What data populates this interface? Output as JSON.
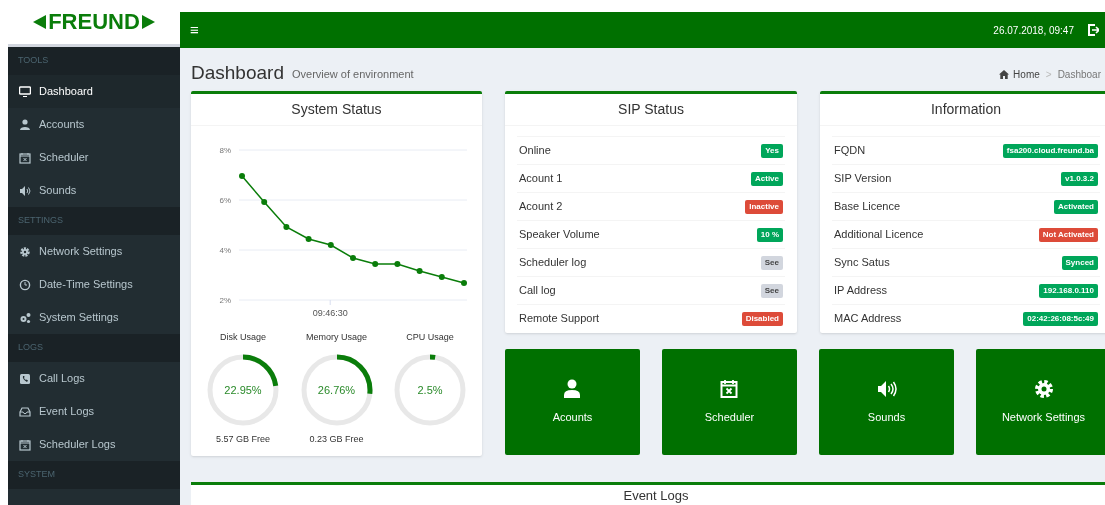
{
  "logo": {
    "text": "FREUND"
  },
  "topbar": {
    "menu_glyph": "≡",
    "datetime": "26.07.2018, 09:47"
  },
  "sidebar": {
    "sections": [
      {
        "title": "TOOLS",
        "items": [
          {
            "label": "Dashboard",
            "selected": true
          },
          {
            "label": "Accounts",
            "selected": false
          },
          {
            "label": "Scheduler",
            "selected": false
          },
          {
            "label": "Sounds",
            "selected": false
          }
        ]
      },
      {
        "title": "SETTINGS",
        "items": [
          {
            "label": "Network Settings",
            "selected": false
          },
          {
            "label": "Date-Time Settings",
            "selected": false
          },
          {
            "label": "System Settings",
            "selected": false
          }
        ]
      },
      {
        "title": "LOGS",
        "items": [
          {
            "label": "Call Logs",
            "selected": false
          },
          {
            "label": "Event Logs",
            "selected": false
          },
          {
            "label": "Scheduler Logs",
            "selected": false
          }
        ]
      },
      {
        "title": "SYSTEM"
      }
    ]
  },
  "page_header": {
    "title": "Dashboard",
    "subtitle": "Overview of environment",
    "breadcrumb": [
      "Home",
      "Dashboar"
    ],
    "breadcrumb_separator": ">"
  },
  "system_status": {
    "title": "System Status",
    "chart_data": {
      "type": "line",
      "series": [
        {
          "color": "#0a7d0a",
          "marker": true,
          "values": [
            6.96,
            5.92,
            4.92,
            4.44,
            4.2,
            3.68,
            3.44,
            3.44,
            3.16,
            2.92,
            2.68
          ]
        }
      ],
      "ylim": [
        2,
        8
      ],
      "yticks": [
        {
          "value": 2,
          "label": "2%"
        },
        {
          "value": 4,
          "label": "4%"
        },
        {
          "value": 6,
          "label": "6%"
        },
        {
          "value": 8,
          "label": "8%"
        }
      ],
      "annotations": [
        "09:46:30"
      ]
    },
    "gauges": [
      {
        "label": "Disk Usage",
        "reading": "22.95%",
        "level": 0.2295,
        "note": "5.57 GB Free"
      },
      {
        "label": "Memory Usage",
        "reading": "26.76%",
        "level": 0.2676,
        "note": "0.23 GB Free"
      },
      {
        "label": "CPU Usage",
        "reading": "2.5%",
        "level": 0.025
      }
    ]
  },
  "sip_status": {
    "title": "SIP Status",
    "rows": [
      {
        "label": "Online",
        "value": "Yes",
        "color": "#00a65a"
      },
      {
        "label": "Acount 1",
        "value": "Active",
        "color": "#00a65a"
      },
      {
        "label": "Acount 2",
        "value": "Inactive",
        "color": "#dd4b39"
      },
      {
        "label": "Speaker Volume",
        "value": "10 %",
        "color": "#00a65a"
      },
      {
        "label": "Scheduler log",
        "value": "See",
        "color": "#d2d6de"
      },
      {
        "label": "Call log",
        "value": "See",
        "color": "#d2d6de"
      },
      {
        "label": "Remote Support",
        "value": "Disabled",
        "color": "#dd4b39"
      }
    ]
  },
  "information": {
    "title": "Information",
    "rows": [
      {
        "label": "FQDN",
        "value": "fsa200.cloud.freund.ba",
        "color": "#00a65a"
      },
      {
        "label": "SIP Version",
        "value": "v1.0.3.2",
        "color": "#00a65a"
      },
      {
        "label": "Base Licence",
        "value": "Activated",
        "color": "#00a65a"
      },
      {
        "label": "Additional Licence",
        "value": "Not Activated",
        "color": "#dd4b39"
      },
      {
        "label": "Sync Satus",
        "value": "Synced",
        "color": "#00a65a"
      },
      {
        "label": "IP Address",
        "value": "192.168.0.110",
        "color": "#00a65a"
      },
      {
        "label": "MAC Address",
        "value": "02:42:26:08:5c:49",
        "color": "#00a65a"
      }
    ]
  },
  "tiles": [
    {
      "label": "Acounts",
      "kind": "user"
    },
    {
      "label": "Scheduler",
      "kind": "calendar"
    },
    {
      "label": "Sounds",
      "kind": "speaker"
    },
    {
      "label": "Network Settings",
      "kind": "gear"
    }
  ],
  "event_logs": {
    "title": "Event Logs"
  }
}
